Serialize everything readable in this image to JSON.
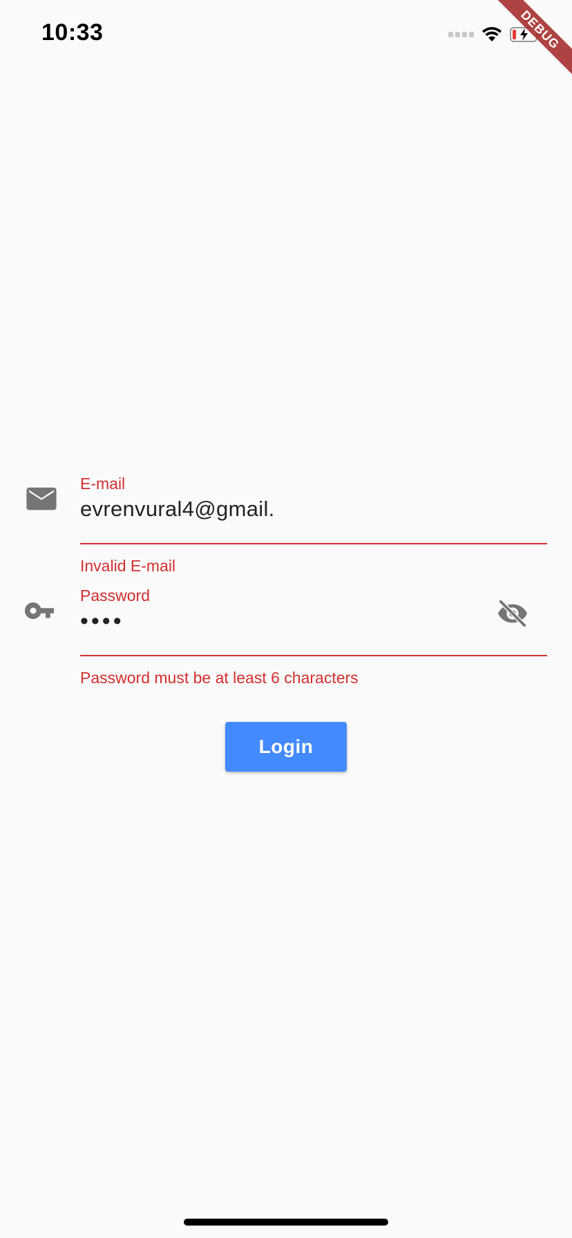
{
  "status_bar": {
    "time": "10:33",
    "signal_icon": "cellular-signal-icon",
    "wifi_icon": "wifi-icon",
    "battery_icon": "battery-charging-icon"
  },
  "debug_banner": {
    "label": "DEBUG"
  },
  "email_field": {
    "icon": "mail-icon",
    "label": "E-mail",
    "value": "evrenvural4@gmail.",
    "error": "Invalid E-mail"
  },
  "password_field": {
    "icon": "key-icon",
    "label": "Password",
    "value": "••••",
    "error": "Password must be at least 6 characters",
    "visibility_icon": "visibility-off-icon"
  },
  "login_button": {
    "label": "Login"
  },
  "colors": {
    "background": "#fafafa",
    "error": "#d32f2f",
    "accent": "#448aff",
    "icon_gray": "#757575"
  }
}
